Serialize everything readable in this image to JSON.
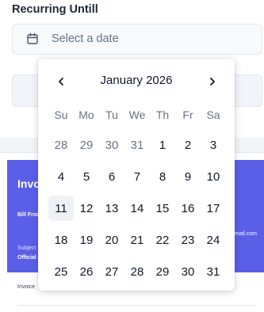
{
  "form": {
    "recurring_label": "Recurring Untill",
    "date_placeholder": "Select a date"
  },
  "invoice_preview": {
    "title": "Invo",
    "bill_from": "Bill From",
    "email_fragment": "mail.com",
    "subject_label": "Subject",
    "subject_value": "Official C",
    "invoice_label": "Invoice"
  },
  "calendar": {
    "month_label": "January 2026",
    "weekdays": [
      "Su",
      "Mo",
      "Tu",
      "We",
      "Th",
      "Fr",
      "Sa"
    ],
    "weeks": [
      [
        {
          "d": "28",
          "outside": true
        },
        {
          "d": "29",
          "outside": true
        },
        {
          "d": "30",
          "outside": true
        },
        {
          "d": "31",
          "outside": true
        },
        {
          "d": "1"
        },
        {
          "d": "2"
        },
        {
          "d": "3"
        }
      ],
      [
        {
          "d": "4"
        },
        {
          "d": "5"
        },
        {
          "d": "6"
        },
        {
          "d": "7"
        },
        {
          "d": "8"
        },
        {
          "d": "9"
        },
        {
          "d": "10"
        }
      ],
      [
        {
          "d": "11",
          "today": true
        },
        {
          "d": "12"
        },
        {
          "d": "13"
        },
        {
          "d": "14"
        },
        {
          "d": "15"
        },
        {
          "d": "16"
        },
        {
          "d": "17"
        }
      ],
      [
        {
          "d": "18"
        },
        {
          "d": "19"
        },
        {
          "d": "20"
        },
        {
          "d": "21"
        },
        {
          "d": "22"
        },
        {
          "d": "23"
        },
        {
          "d": "24"
        }
      ],
      [
        {
          "d": "25"
        },
        {
          "d": "26"
        },
        {
          "d": "27"
        },
        {
          "d": "28"
        },
        {
          "d": "29"
        },
        {
          "d": "30"
        },
        {
          "d": "31"
        }
      ]
    ],
    "prev_icon": "chevron-left-icon",
    "next_icon": "chevron-right-icon"
  },
  "colors": {
    "banner": "#5b5fe8",
    "today_bg": "#eef2f7"
  }
}
